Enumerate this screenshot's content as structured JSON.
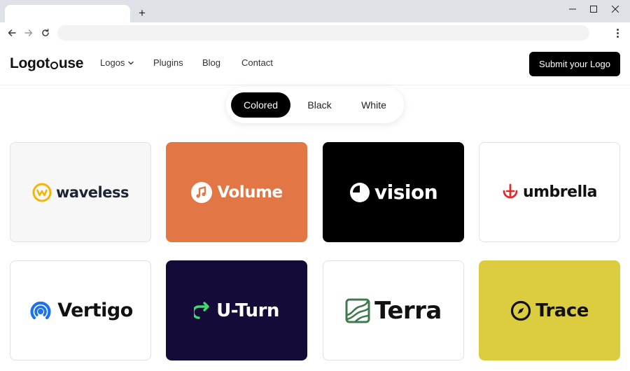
{
  "browser": {
    "new_tab_symbol": "+",
    "address_value": "",
    "icons": [
      "back-arrow-icon",
      "forward-arrow-icon",
      "reload-icon",
      "kebab-menu-icon",
      "minimize-icon",
      "maximize-icon",
      "close-icon"
    ]
  },
  "header": {
    "brand_part1": "Logo",
    "brand_part2": "use",
    "nav": {
      "logos": "Logos",
      "plugins": "Plugins",
      "blog": "Blog",
      "contact": "Contact"
    },
    "submit_label": "Submit your Logo"
  },
  "filters": {
    "options": [
      "Colored",
      "Black",
      "White"
    ],
    "selected": "Colored"
  },
  "cards": [
    {
      "name": "waveless",
      "bg": "#f7f7f7",
      "fg": "#1c2433",
      "accent": "#f2b705",
      "icon": "wave-circle-icon"
    },
    {
      "name": "Volume",
      "bg": "#e37645",
      "fg": "#ffffff",
      "accent": "#ffffff",
      "icon": "music-note-icon"
    },
    {
      "name": "vision",
      "bg": "#000000",
      "fg": "#ffffff",
      "accent": "#ffffff",
      "icon": "eye-circle-icon"
    },
    {
      "name": "umbrella",
      "bg": "#ffffff",
      "fg": "#111111",
      "accent": "#e02b2b",
      "icon": "umbrella-icon"
    },
    {
      "name": "Vertigo",
      "bg": "#ffffff",
      "fg": "#111111",
      "accent": "#1a73e8",
      "icon": "signal-icon"
    },
    {
      "name": "U-Turn",
      "bg": "#150b38",
      "fg": "#ffffff",
      "accent": "#3ddc6b",
      "icon": "u-turn-arrow-icon"
    },
    {
      "name": "Terra",
      "bg": "#ffffff",
      "fg": "#111111",
      "accent": "#3f7a4e",
      "icon": "terrain-tile-icon"
    },
    {
      "name": "Trace",
      "bg": "#dccc40",
      "fg": "#111111",
      "accent": "#111111",
      "icon": "compass-icon"
    }
  ]
}
